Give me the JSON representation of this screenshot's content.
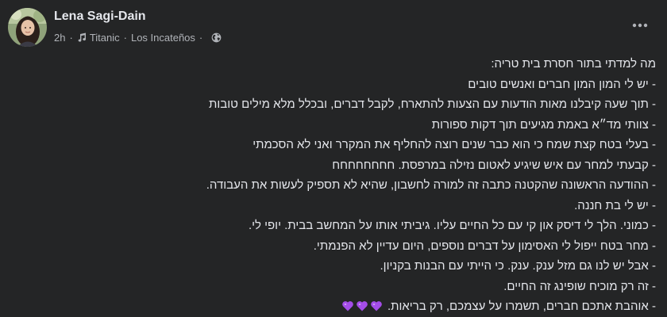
{
  "author": {
    "name": "Lena Sagi-Dain"
  },
  "meta": {
    "time": "2h",
    "song": "Titanic",
    "artist": "Los Incateños",
    "separator": "·",
    "music_icon": "music-note-icon",
    "privacy_icon": "globe-icon"
  },
  "post": {
    "lines": [
      "מה למדתי בתור חסרת בית טריה:",
      "- יש לי המון המון חברים ואנשים טובים",
      "- תוך שעה קיבלנו מאות הודעות עם הצעות להתארח, לקבל דברים, ובכלל מלא מילים טובות",
      "- צוותי מד״א באמת מגיעים תוך דקות ספורות",
      "- בעלי בטח קצת שמח כי הוא כבר שנים רוצה להחליף את המקרר ואני לא הסכמתי",
      "- קבעתי למחר עם איש שיגיע לאטום נזילה במרפסת. חחחחחחחח",
      "- ההודעה הראשונה שהקטנה כתבה זה למורה לחשבון, שהיא לא תספיק לעשות את העבודה.",
      "- יש לי בת חננה.",
      "- כמוני. הלך לי דיסק און קי עם כל החיים עליו. גיביתי אותו על המחשב בבית. יופי לי.",
      "- מחר בטח ייפול לי האסימון על דברים נוספים, היום עדיין לא הפנמתי.",
      "- אבל יש לנו גם מזל ענק. ענק. כי הייתי עם הבנות בקניון.",
      "- זה רק מוכיח שופינג זה החיים.",
      "- אוהבת אתכם חברים, תשמרו על עצמכם, רק בריאות."
    ],
    "emoji": "purple-heart",
    "emoji_count": 3
  },
  "colors": {
    "background": "#242526",
    "primary_text": "#e4e6eb",
    "secondary_text": "#b0b3b8",
    "heart": "#a44de8"
  }
}
